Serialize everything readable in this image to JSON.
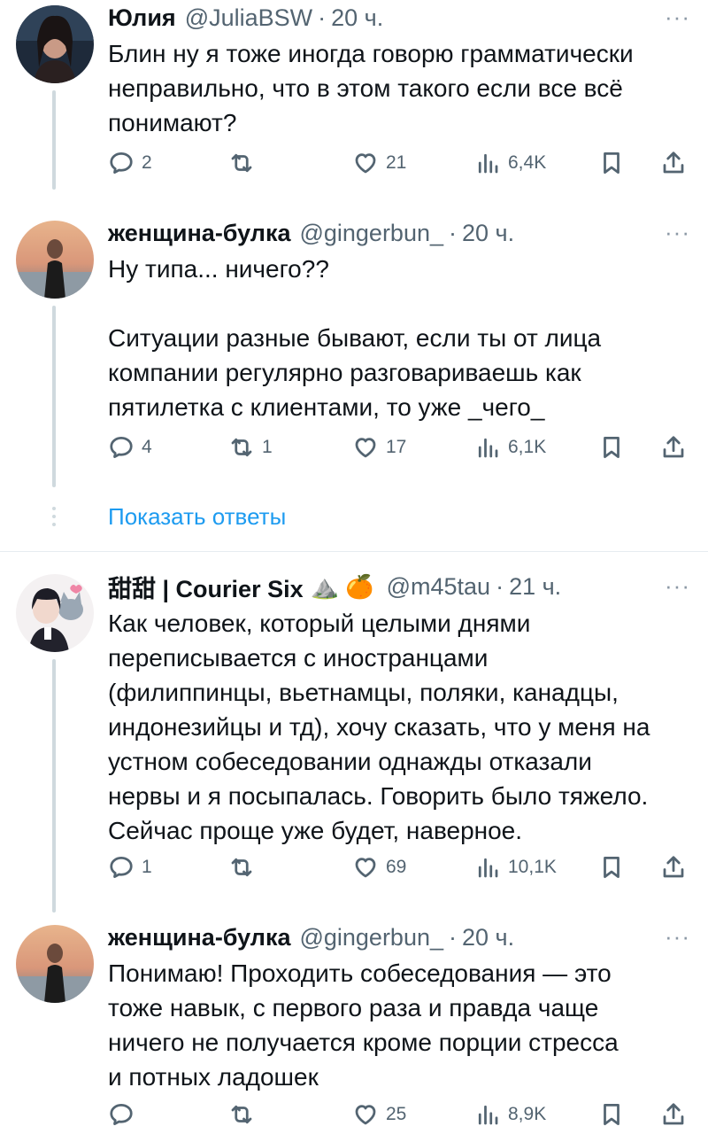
{
  "tweets": [
    {
      "name": "Юлия",
      "handle": "@JuliaBSW",
      "time": "20 ч.",
      "text": [
        "Блин ну я тоже иногда говорю грамматически",
        "неправильно, что в этом такого если все всё",
        "понимают?"
      ],
      "replies": "2",
      "retweets": "",
      "likes": "21",
      "views": "6,4K"
    },
    {
      "name": "женщина-булка",
      "handle": "@gingerbun_",
      "time": "20 ч.",
      "text": [
        "Ну типа... ничего??"
      ],
      "text2": [
        "Ситуации разные бывают, если ты от лица",
        "компании регулярно разговариваешь как",
        "пятилетка с клиентами, то уже _чего_"
      ],
      "replies": "4",
      "retweets": "1",
      "likes": "17",
      "views": "6,1K"
    },
    {
      "name": "甜甜 | Courier Six",
      "name_emoji": "⛰️ 🍊",
      "handle": "@m45tau",
      "time": "21 ч.",
      "text": [
        "Как человек, который целыми днями",
        "переписывается с иностранцами",
        "(филиппинцы, вьетнамцы, поляки, канадцы,",
        "индонезийцы и тд), хочу сказать, что у меня на",
        "устном собеседовании однажды отказали",
        "нервы и я посыпалась. Говорить было тяжело.",
        "Сейчас проще уже будет, наверное."
      ],
      "replies": "1",
      "retweets": "",
      "likes": "69",
      "views": "10,1K"
    },
    {
      "name": "женщина-булка",
      "handle": "@gingerbun_",
      "time": "20 ч.",
      "text": [
        "Понимаю! Проходить собеседования — это",
        "тоже навык, с первого раза и правда чаще",
        "ничего не получается кроме порции стресса",
        "и потных ладошек"
      ],
      "replies": "",
      "retweets": "",
      "likes": "25",
      "views": "8,9K"
    }
  ],
  "show_replies": "Показать ответы",
  "more_icon": "···",
  "colors": {
    "link": "#1d9bf0",
    "secondary": "#536471"
  }
}
